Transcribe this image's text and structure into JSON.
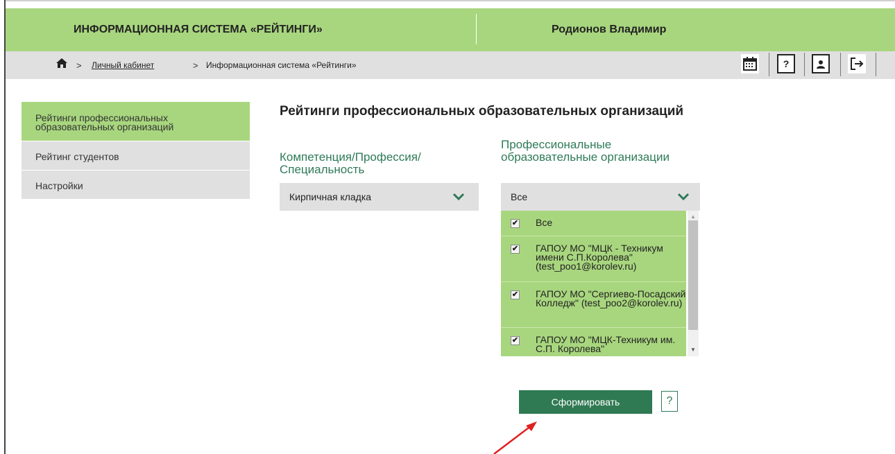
{
  "header": {
    "title": "ИНФОРМАЦИОННАЯ СИСТЕМА «РЕЙТИНГИ»",
    "user": "Родионов Владимир"
  },
  "breadcrumb": {
    "home_icon": "home-icon",
    "separator": ">",
    "items": [
      "Личный кабинет",
      "Информационная система «Рейтинги»"
    ]
  },
  "toolbar": {
    "icons": [
      "calendar-icon",
      "help-icon",
      "profile-icon",
      "logout-icon"
    ],
    "help_glyph": "?"
  },
  "sidebar": {
    "items": [
      {
        "label": "Рейтинги профессиональных образовательных организаций",
        "active": true
      },
      {
        "label": "Рейтинг студентов",
        "active": false
      },
      {
        "label": "Настройки",
        "active": false
      }
    ]
  },
  "main": {
    "heading": "Рейтинги профессиональных образовательных организаций",
    "competence": {
      "label": "Компетенция/Профессия/ Специальность",
      "value": "Кирпичная кладка"
    },
    "orgs": {
      "label": "Профессиональные образовательные организации",
      "value": "Все",
      "options": [
        {
          "label": "Все",
          "checked": true
        },
        {
          "label": "ГАПОУ МО \"МЦК - Техникум имени С.П.Королева\" (test_poo1@korolev.ru)",
          "checked": true
        },
        {
          "label": "ГАПОУ МО \"Сергиево-Посадский Колледж\" (test_poo2@korolev.ru)",
          "checked": true
        },
        {
          "label": "ГАПОУ МО \"МЦК-Техникум им. С.П. Королева\"",
          "checked": true
        }
      ]
    },
    "submit_label": "Сформировать",
    "help_label": "?"
  },
  "colors": {
    "accent_green": "#a8d67e",
    "button_green": "#2f7a53",
    "label_green": "#2e7a58",
    "arrow_red": "#e02020"
  }
}
